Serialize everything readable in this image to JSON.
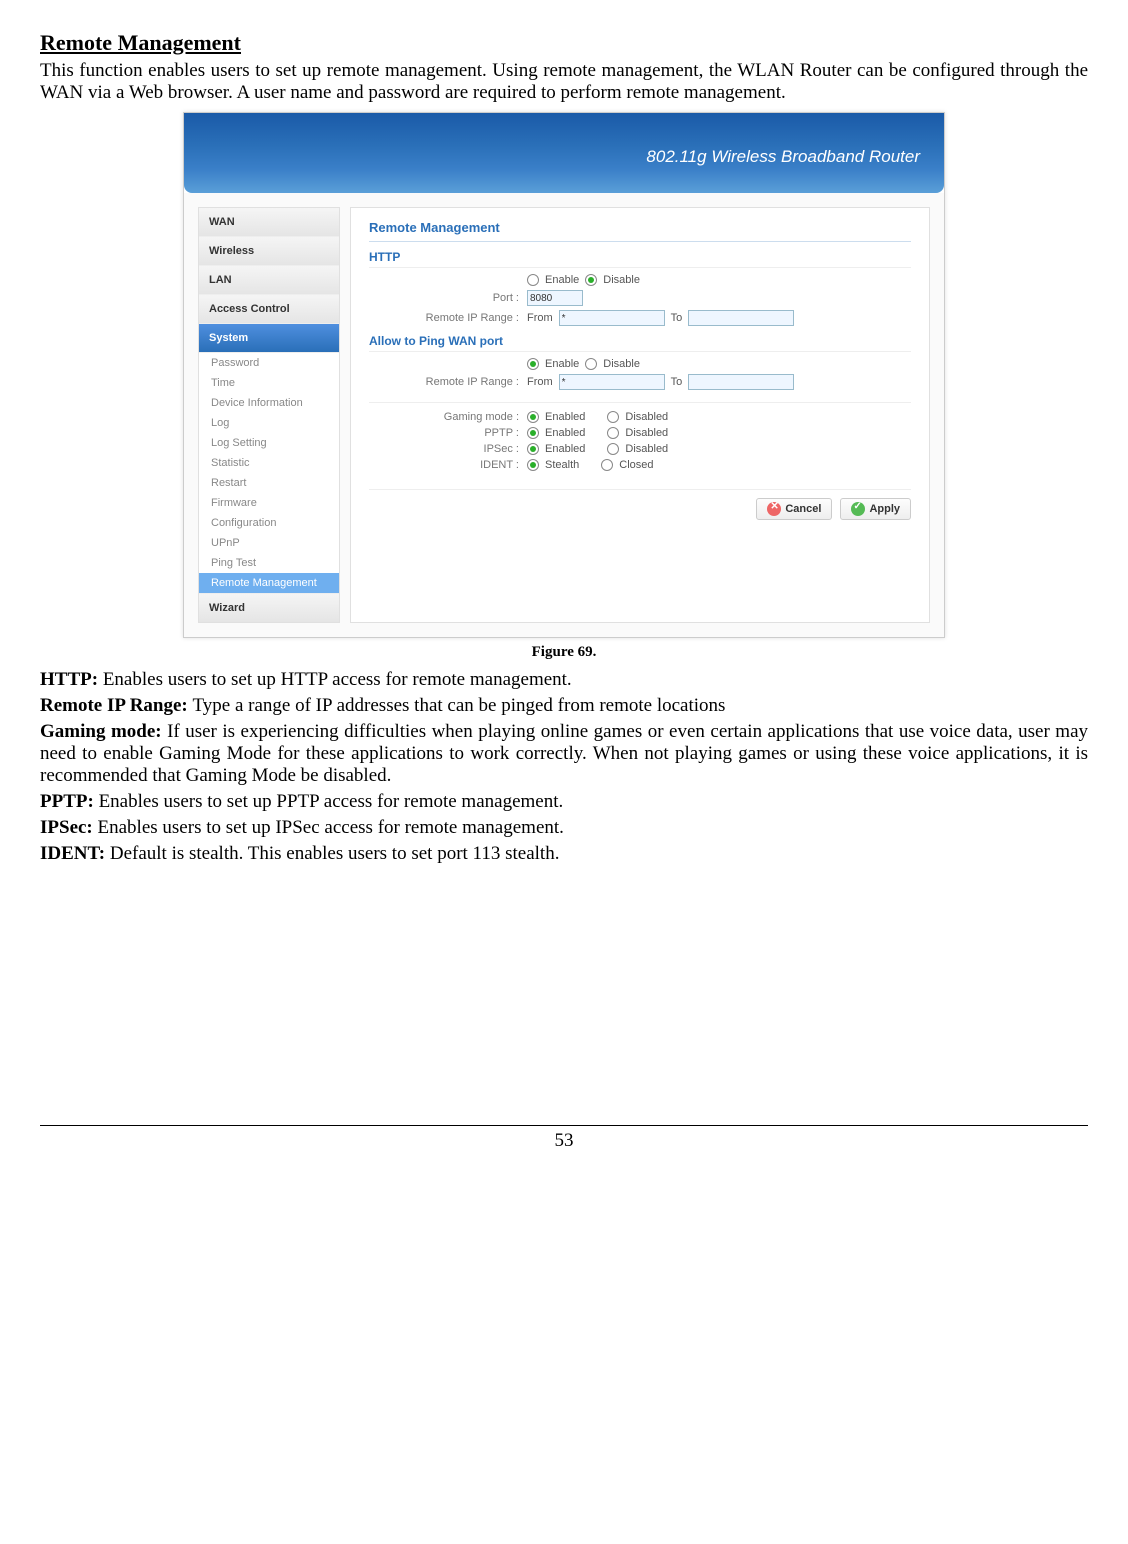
{
  "doc": {
    "section_title": "Remote Management",
    "intro": "This function enables users to set up remote management. Using remote management, the WLAN Router can be configured through the WAN via a Web browser. A user name and password are required to perform remote management.",
    "figure_caption": "Figure 69.",
    "http_def": "Enables users to set up HTTP access for remote management.",
    "remote_ip_def": "Type a range of IP addresses that can be pinged from remote locations",
    "gaming_def": "If user is experiencing difficulties when playing online games or even certain applications that use voice data, user may need to enable Gaming Mode for these applications to work correctly. When not playing games or using these voice applications, it is recommended that Gaming Mode be disabled.",
    "pptp_def": "Enables users to set up PPTP access for remote management.",
    "ipsec_def": "Enables users to set up IPSec access for remote management.",
    "ident_def": "Default is stealth.  This enables users to set port 113 stealth.",
    "page_number": "53"
  },
  "ui": {
    "banner": "802.11g Wireless Broadband Router",
    "sidebar_main": [
      "WAN",
      "Wireless",
      "LAN",
      "Access Control",
      "System"
    ],
    "sidebar_active_index": 4,
    "sidebar_sub": [
      "Password",
      "Time",
      "Device Information",
      "Log",
      "Log Setting",
      "Statistic",
      "Restart",
      "Firmware",
      "Configuration",
      "UPnP",
      "Ping Test",
      "Remote Management"
    ],
    "sidebar_sub_active_index": 11,
    "sidebar_bottom": "Wizard",
    "panel_title": "Remote Management",
    "http": {
      "section": "HTTP",
      "enable": "Enable",
      "disable": "Disable",
      "selected": "disable",
      "port_label": "Port :",
      "port_value": "8080",
      "ip_label": "Remote IP Range :",
      "from": "From",
      "from_value": "*",
      "to": "To",
      "to_value": ""
    },
    "ping": {
      "section": "Allow to Ping WAN port",
      "enable": "Enable",
      "disable": "Disable",
      "selected": "enable",
      "ip_label": "Remote IP Range :",
      "from": "From",
      "from_value": "*",
      "to": "To",
      "to_value": ""
    },
    "opts": {
      "gaming": {
        "label": "Gaming mode :",
        "enabled": "Enabled",
        "disabled": "Disabled",
        "selected": "enabled"
      },
      "pptp": {
        "label": "PPTP :",
        "enabled": "Enabled",
        "disabled": "Disabled",
        "selected": "enabled"
      },
      "ipsec": {
        "label": "IPSec :",
        "enabled": "Enabled",
        "disabled": "Disabled",
        "selected": "enabled"
      },
      "ident": {
        "label": "IDENT :",
        "enabled": "Stealth",
        "disabled": "Closed",
        "selected": "enabled"
      }
    },
    "buttons": {
      "cancel": "Cancel",
      "apply": "Apply"
    }
  }
}
